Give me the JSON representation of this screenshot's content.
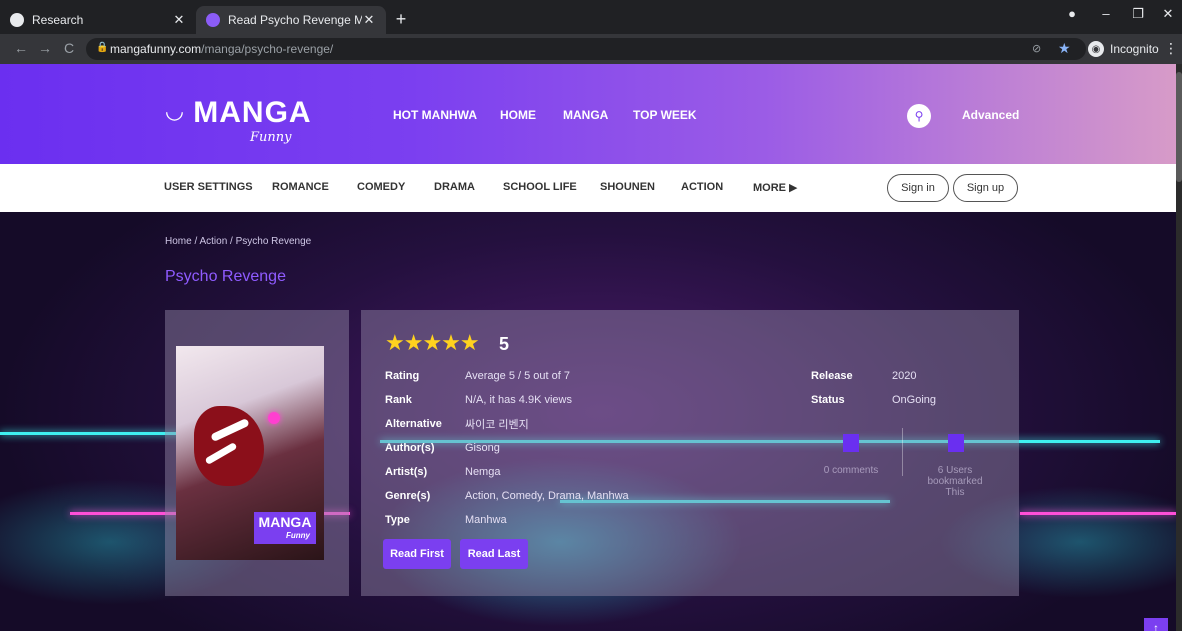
{
  "browser": {
    "tabs": [
      {
        "title": "Research",
        "active": false
      },
      {
        "title": "Read Psycho Revenge Manga – M",
        "active": true
      }
    ],
    "new_tab_symbol": "+",
    "url_host": "mangafunny.com",
    "url_path": "/manga/psycho-revenge/",
    "profile_label": "Incognito"
  },
  "site": {
    "logo_text": "MANGA",
    "logo_subtext": "Funny",
    "main_nav": [
      "HOT MANHWA",
      "HOME",
      "MANGA",
      "TOP WEEK"
    ],
    "advanced_label": "Advanced",
    "sub_nav": [
      "USER SETTINGS",
      "ROMANCE",
      "COMEDY",
      "DRAMA",
      "SCHOOL LIFE",
      "SHOUNEN",
      "ACTION",
      "MORE ▶"
    ],
    "sign_in": "Sign in",
    "sign_up": "Sign up"
  },
  "manga": {
    "breadcrumb": "Home / Action / Psycho Revenge",
    "title": "Psycho Revenge",
    "stars": "★★★★★",
    "score": "5",
    "rating_label": "Rating",
    "rating_value": "Average 5 / 5 out of 7",
    "rank_label": "Rank",
    "rank_value": "N/A, it has 4.9K views",
    "alternative_label": "Alternative",
    "alternative_value": "싸이코 리벤지",
    "authors_label": "Author(s)",
    "authors_value": "Gisong",
    "artists_label": "Artist(s)",
    "artists_value": "Nemga",
    "genres_label": "Genre(s)",
    "genres_value": "Action,  Comedy,  Drama,  Manhwa",
    "type_label": "Type",
    "type_value": "Manhwa",
    "release_label": "Release",
    "release_value": "2020",
    "status_label": "Status",
    "status_value": "OnGoing",
    "comments": "0 comments",
    "bookmarks": "6 Users bookmarked This",
    "read_first": "Read First",
    "read_last": "Read Last",
    "cover_badge": "MANGA",
    "cover_badge_sub": "Funny"
  },
  "colors": {
    "accent": "#7b3ff0",
    "star": "#ffd21f"
  }
}
